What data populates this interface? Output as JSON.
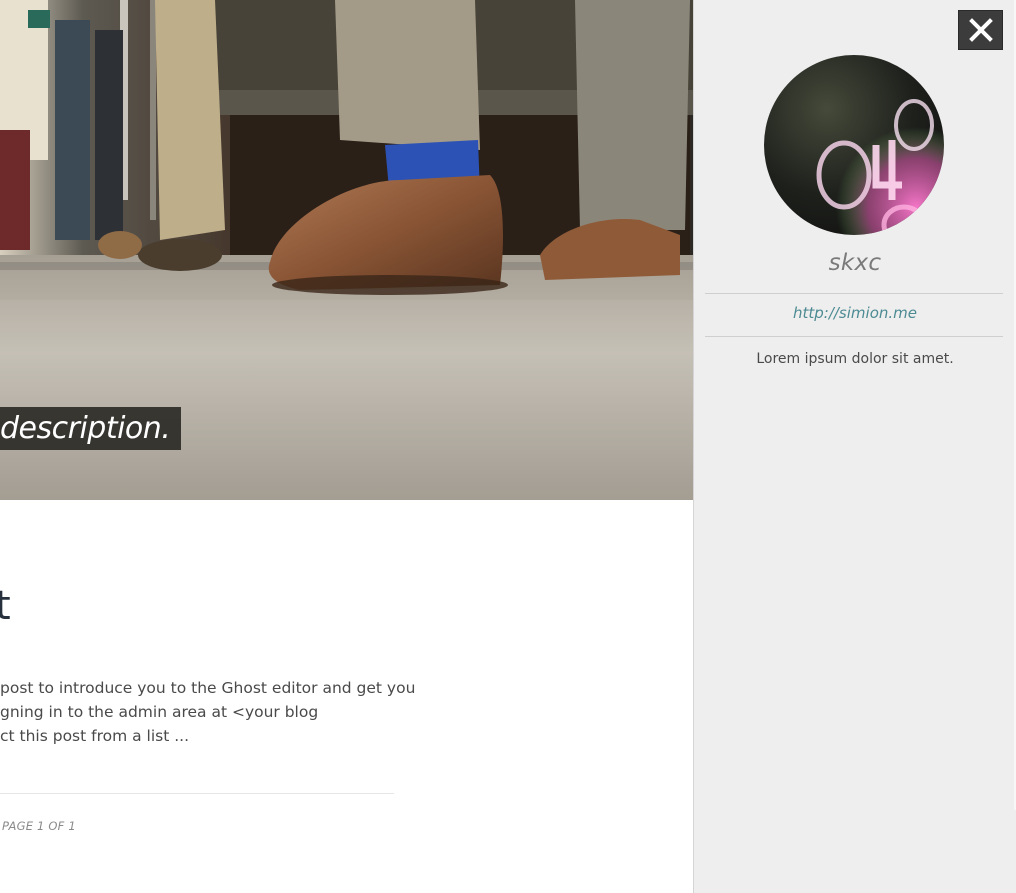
{
  "hero": {
    "description": "description."
  },
  "post": {
    "title": "t",
    "excerpt_lines": [
      "post to introduce you to the Ghost editor and get you",
      "gning in to the admin area at <your blog",
      "ct this post from a list ..."
    ]
  },
  "pagination": {
    "label": "PAGE 1 OF 1"
  },
  "sidebar": {
    "close_icon": "close-icon",
    "author_name": "skxc",
    "author_link": "http://simion.me",
    "author_bio": "Lorem ipsum dolor sit amet."
  },
  "colors": {
    "sidebar_bg": "#eeeeee",
    "link": "#4d8b93",
    "title": "#26313d",
    "close_bg": "#3c3c3c"
  }
}
